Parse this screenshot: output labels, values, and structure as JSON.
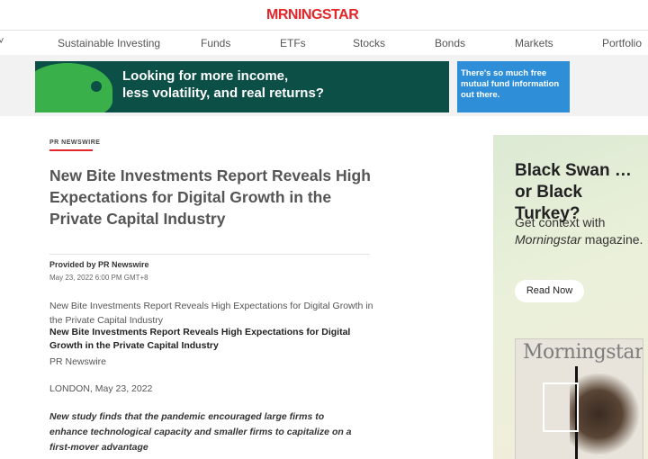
{
  "brand": {
    "logo": "MRNINGSTAR",
    "logo_color": "#e3262b"
  },
  "nav": {
    "chevron": "˅",
    "items": [
      "Sustainable Investing",
      "Funds",
      "ETFs",
      "Stocks",
      "Bonds",
      "Markets",
      "Portfolio"
    ]
  },
  "top_ad": {
    "headline_line1": "Looking for more income,",
    "headline_line2": "less volatility, and real returns?",
    "side_text": "There's so much free mutual fund information out there.",
    "bg_color": "#0b4f47",
    "side_color": "#2e8fd8"
  },
  "article": {
    "kicker": "PR NEWSWIRE",
    "title": "New Bite Investments Report Reveals High Expectations for Digital Growth in the Private Capital Industry",
    "provided_by": "Provided by PR Newswire",
    "date": "May 23, 2022 6:00 PM GMT+8",
    "para_grey": "New Bite Investments Report Reveals High Expectations for Digital Growth in the Private Capital Industry",
    "para_bold": "New Bite Investments Report Reveals High Expectations for Digital Growth in the Private Capital Industry",
    "source": "PR Newswire",
    "location": "LONDON, May 23, 2022",
    "summary": "New study finds that the pandemic encouraged large firms to enhance technological capacity and smaller firms to capitalize on a first-mover advantage"
  },
  "side_ad": {
    "headline": "Black Swan … or Black Turkey?",
    "sub_prefix": "Get context with ",
    "sub_italic": "Morningstar",
    "sub_suffix": " magazine.",
    "button": "Read Now",
    "magazine_title": "Morningstar"
  }
}
